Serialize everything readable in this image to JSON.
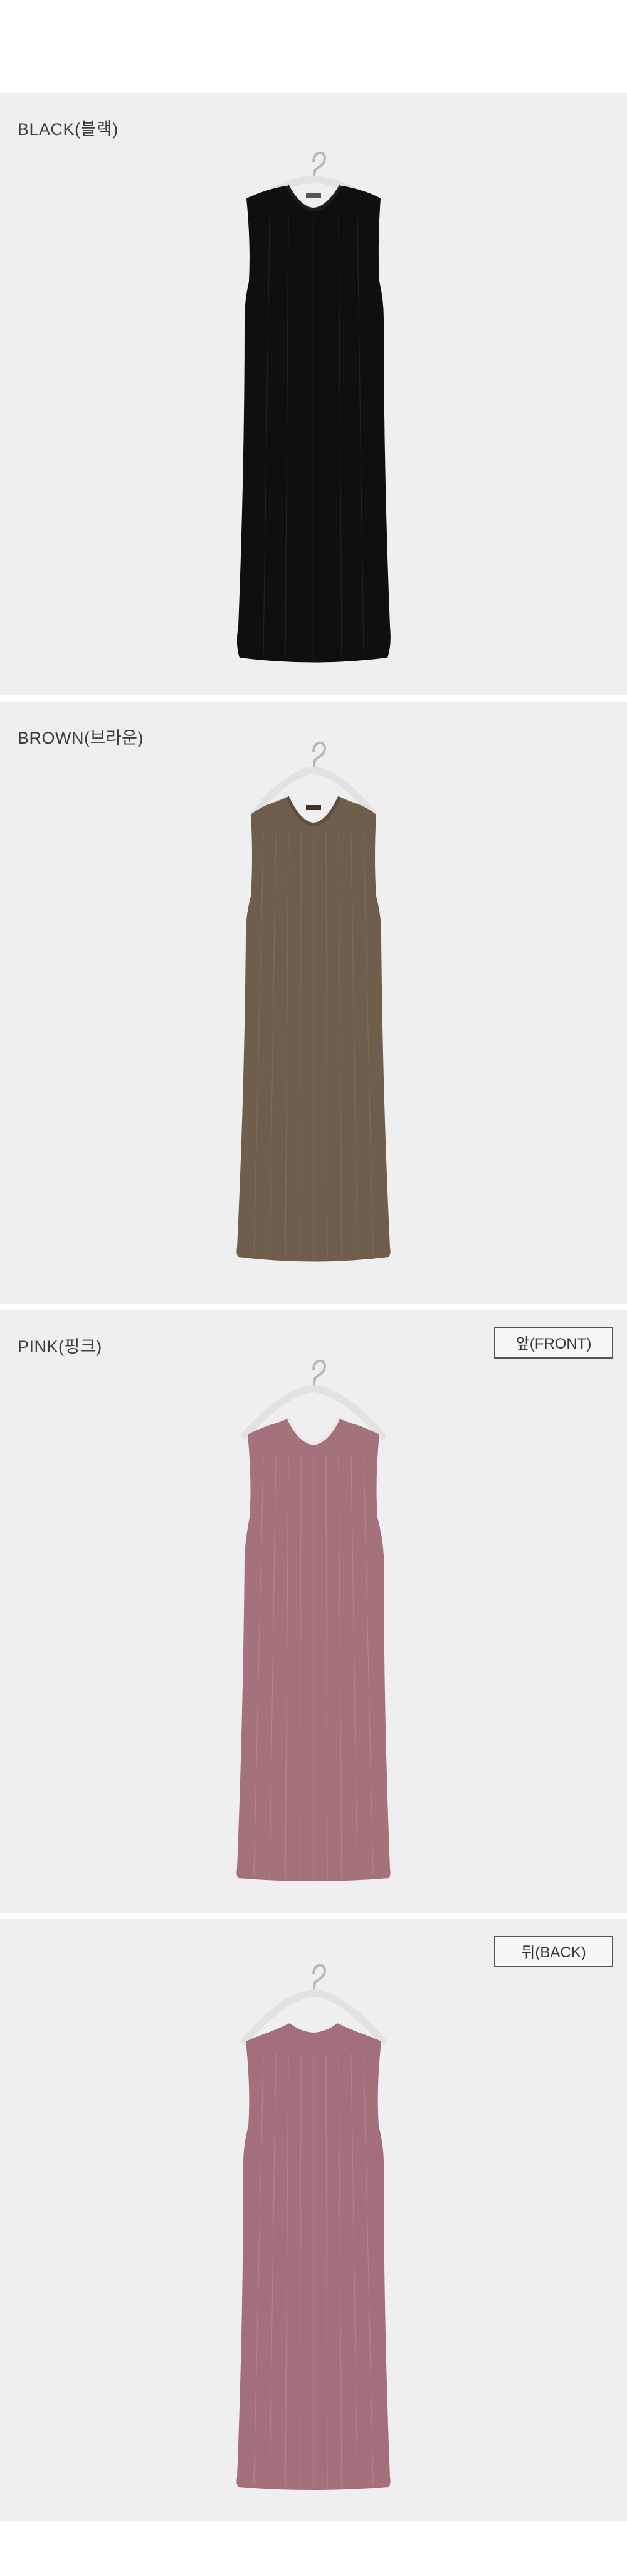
{
  "panels": [
    {
      "label": "BLACK(블랙)",
      "view_tag": "",
      "color": "#0f0f0f",
      "shade": "#060606",
      "rib": "#2a2a2a",
      "neck_tape": "#1c1c1c"
    },
    {
      "label": "BROWN(브라운)",
      "view_tag": "",
      "color": "#6f5e4c",
      "shade": "#5a4b3b",
      "rib": "#806f5d",
      "neck_tape": "#5f4f3f"
    },
    {
      "label": "PINK(핑크)",
      "view_tag": "앞(FRONT)",
      "color": "#a3727b",
      "shade": "#8e5f68",
      "rib": "#b7868f",
      "neck_tape": "#f2e6e6"
    },
    {
      "label": "",
      "view_tag": "뒤(BACK)",
      "color": "#a36f7a",
      "shade": "#8d5c66",
      "rib": "#b7838d",
      "neck_tape": "#a36f7a"
    }
  ],
  "colors": {
    "background": "#ffffff",
    "panel_bg": "#efefef",
    "hanger": "#e6e6e6",
    "hanger_hook": "#b9b9b9"
  }
}
